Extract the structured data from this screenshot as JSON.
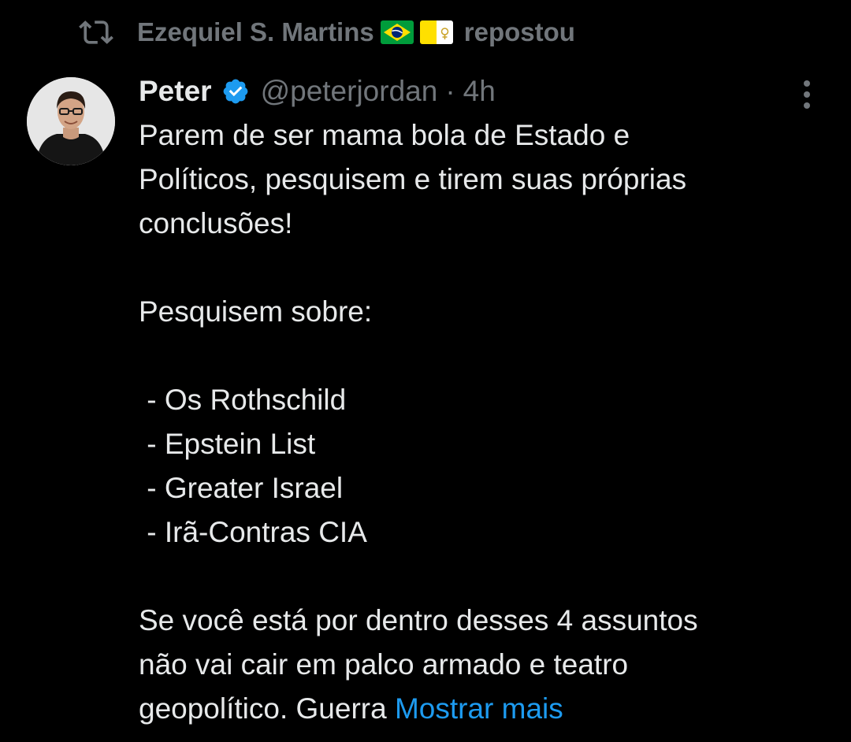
{
  "repost": {
    "icon": "repost-icon",
    "user": "Ezequiel S. Martins",
    "flags": [
      "brazil-flag",
      "vatican-flag"
    ],
    "label": "repostou"
  },
  "tweet": {
    "avatar": "avatar",
    "display_name": "Peter",
    "verified_icon": "verified-badge-icon",
    "handle": "@peterjordan",
    "separator": "·",
    "time": "4h",
    "more_icon": "more-options-icon",
    "lines": [
      "Parem de ser mama bola de Estado e",
      "Políticos, pesquisem e tirem suas próprias",
      "conclusões!",
      "",
      "Pesquisem sobre:",
      "",
      " - Os Rothschild",
      " - Epstein List",
      " - Greater Israel",
      " - Irã-Contras CIA",
      "",
      "Se você está por dentro desses 4 assuntos",
      "não vai cair em palco armado e teatro"
    ],
    "last_line": "geopolítico. Guerra ",
    "show_more": "Mostrar mais"
  },
  "colors": {
    "background": "#000000",
    "text": "#e7e9ea",
    "secondary": "#71767b",
    "accent": "#1d9bf0"
  }
}
